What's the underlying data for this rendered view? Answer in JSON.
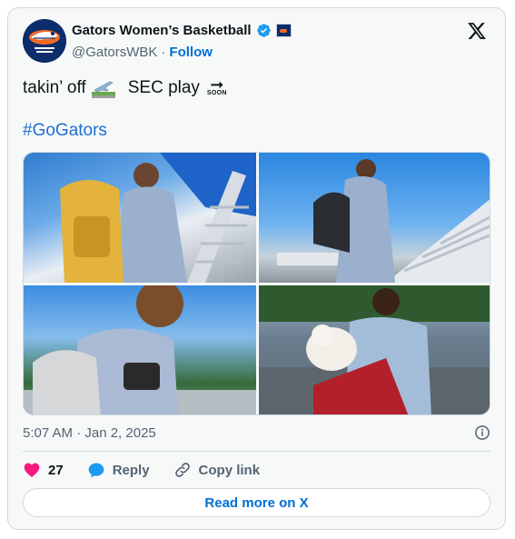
{
  "account": {
    "name": "Gators Women’s Basketball",
    "handle": "@GatorsWBK",
    "separator": "·",
    "follow_label": "Follow"
  },
  "tweet": {
    "text_part1": "takin’ off",
    "text_part2": "SEC play",
    "soon_label": "SOON",
    "hashtag": "#GoGators"
  },
  "media": [
    {
      "alt": "player with yellow backpack climbing airplane stairs"
    },
    {
      "alt": "player with black backpack boarding plane"
    },
    {
      "alt": "smiling player with headphones"
    },
    {
      "alt": "player holding stuffed animal on tarmac"
    }
  ],
  "meta": {
    "timestamp": "5:07 AM · Jan 2, 2025"
  },
  "actions": {
    "likes_count": "27",
    "reply_label": "Reply",
    "copy_link_label": "Copy link"
  },
  "footer": {
    "read_more_label": "Read more on X"
  },
  "colors": {
    "link": "#006fd6",
    "like": "#f91880",
    "reply": "#1d9bf0",
    "verified": "#1d9bf0"
  },
  "icons": [
    "gator-logo-avatar",
    "verified-badge-icon",
    "team-affiliate-badge-icon",
    "x-logo-icon",
    "info-icon",
    "heart-icon",
    "reply-bubble-icon",
    "link-icon",
    "airplane-departure-emoji",
    "soon-arrow-emoji"
  ]
}
